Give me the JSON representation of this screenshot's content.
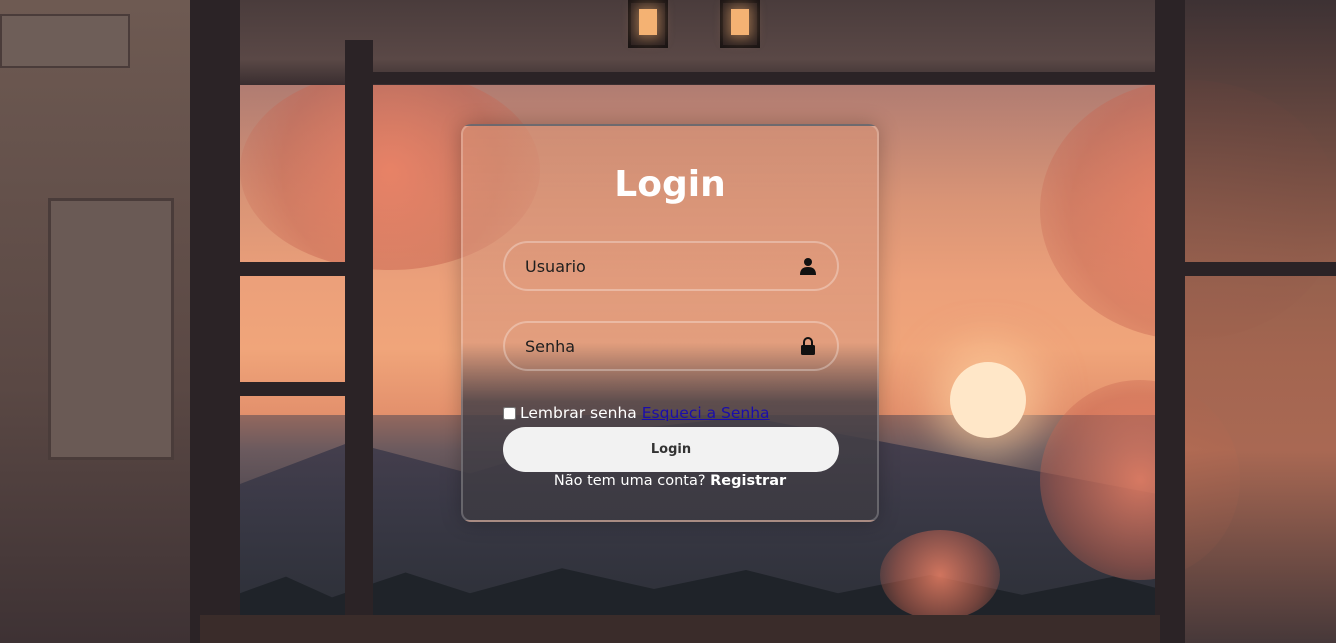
{
  "login": {
    "title": "Login",
    "username": {
      "placeholder": "Usuario",
      "value": "",
      "icon": "user-icon"
    },
    "password": {
      "placeholder": "Senha",
      "value": "",
      "icon": "lock-icon"
    },
    "remember_label": "Lembrar senha",
    "forgot_link": "Esqueci a Senha",
    "submit_label": "Login",
    "no_account_text": "Não tem uma conta?",
    "register_link": "Registrar"
  },
  "colors": {
    "card_border": "#ffffff",
    "button_bg": "#f2f2f2",
    "link_color": "#1a0dab"
  }
}
